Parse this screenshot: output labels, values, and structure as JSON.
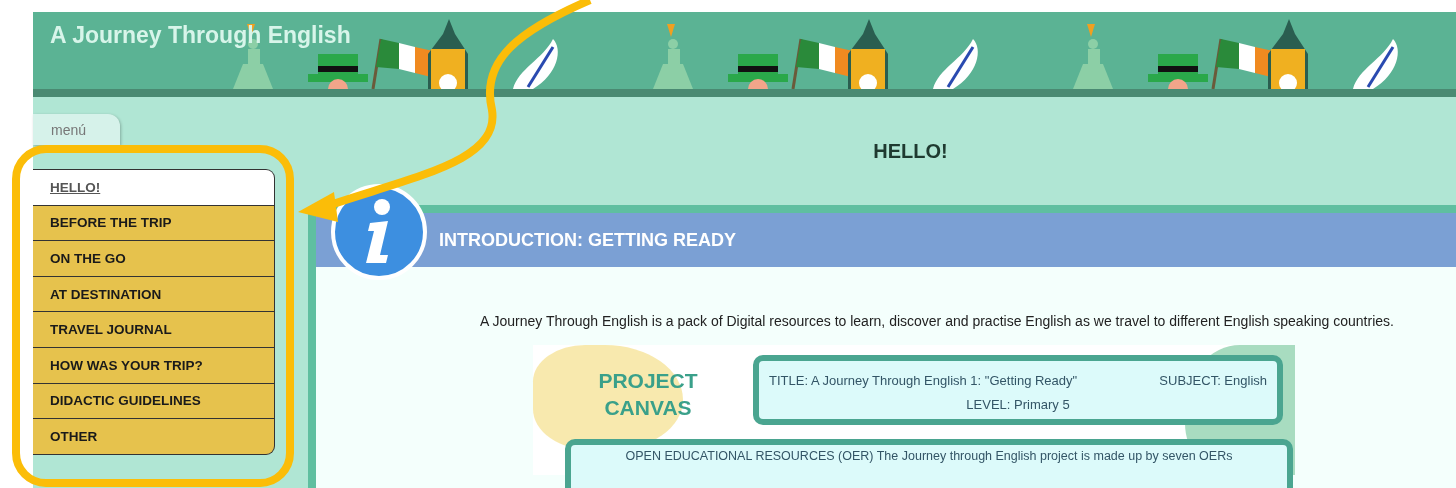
{
  "header": {
    "title": "A Journey Through English"
  },
  "menu": {
    "tab_label": "menú",
    "items": [
      {
        "label": "HELLO!",
        "selected": true
      },
      {
        "label": "BEFORE THE TRIP",
        "selected": false
      },
      {
        "label": "ON THE GO",
        "selected": false
      },
      {
        "label": "AT DESTINATION",
        "selected": false
      },
      {
        "label": "TRAVEL JOURNAL",
        "selected": false
      },
      {
        "label": "HOW WAS YOUR TRIP?",
        "selected": false
      },
      {
        "label": "DIDACTIC GUIDELINES",
        "selected": false
      },
      {
        "label": "OTHER",
        "selected": false
      }
    ]
  },
  "page_title": "HELLO!",
  "section": {
    "title": "INTRODUCTION: GETTING READY",
    "intro": "A Journey Through English is a pack of Digital resources to learn, discover and practise English as we travel to different English speaking countries.",
    "canvas": {
      "heading": "PROJECT CANVAS",
      "title": "TITLE: A Journey Through English 1: \"Getting Ready\"",
      "subject": "SUBJECT: English",
      "level": "LEVEL: Primary 5",
      "oer": "OPEN EDUCATIONAL RESOURCES (OER) The Journey through English project is made up by seven OERs"
    }
  }
}
